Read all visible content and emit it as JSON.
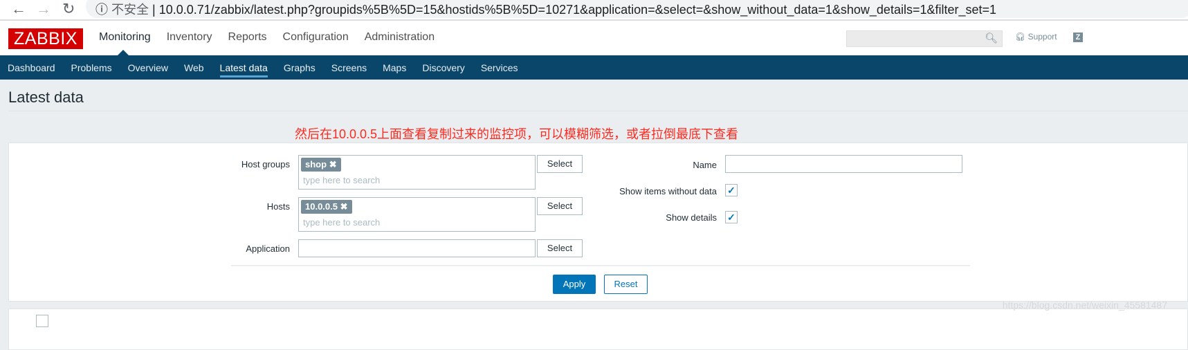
{
  "browser": {
    "insecure_label": "不安全",
    "url": "10.0.0.71/zabbix/latest.php?groupids%5B%5D=15&hostids%5B%5D=10271&application=&select=&show_without_data=1&show_details=1&filter_set=1"
  },
  "header": {
    "logo": "ZABBIX",
    "menu": [
      "Monitoring",
      "Inventory",
      "Reports",
      "Configuration",
      "Administration"
    ],
    "support": "Support",
    "share": "Z"
  },
  "submenu": [
    "Dashboard",
    "Problems",
    "Overview",
    "Web",
    "Latest data",
    "Graphs",
    "Screens",
    "Maps",
    "Discovery",
    "Services"
  ],
  "page": {
    "title": "Latest data",
    "annotation": "然后在10.0.0.5上面查看复制过来的监控项，可以模糊筛选，或者拉倒最底下查看"
  },
  "filter": {
    "host_groups_label": "Host groups",
    "host_group_tag": "shop",
    "hosts_label": "Hosts",
    "host_tag": "10.0.0.5",
    "placeholder": "type here to search",
    "application_label": "Application",
    "application_value": "",
    "select": "Select",
    "name_label": "Name",
    "name_value": "",
    "show_without_data_label": "Show items without data",
    "show_without_data": true,
    "show_details_label": "Show details",
    "show_details": true,
    "apply": "Apply",
    "reset": "Reset"
  },
  "watermark": "https://blog.csdn.net/weixin_45581487",
  "colors": {
    "brand": "#d40000",
    "nav": "#0a466a",
    "accent": "#0275b8",
    "annotation": "#ff2a1f"
  }
}
